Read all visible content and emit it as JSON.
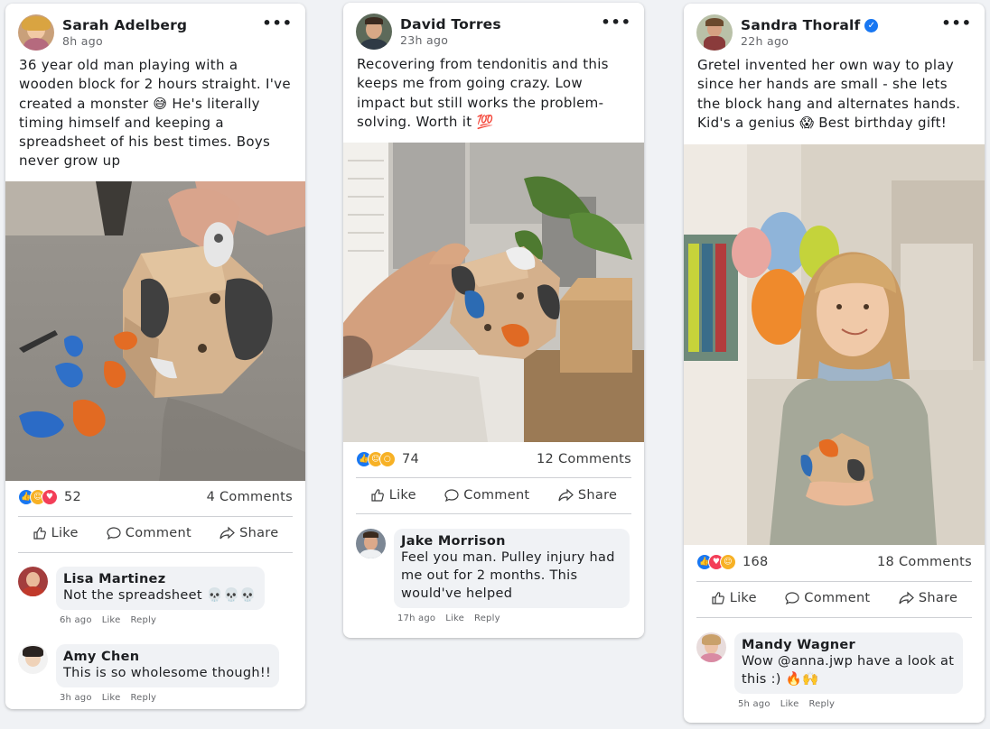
{
  "posts": [
    {
      "author": "Sarah Adelberg",
      "time": "8h ago",
      "more": "•••",
      "text": "36 year old man playing with a wooden block for 2 hours straight. I've created a monster 😅 He's literally timing himself and keeping a spreadsheet of his best times. Boys never grow up",
      "reaction_count": "52",
      "comments_label": "4 Comments",
      "actions": {
        "like": "Like",
        "comment": "Comment",
        "share": "Share"
      },
      "comments": [
        {
          "name": "Lisa Martinez",
          "text": "Not the spreadsheet 💀💀💀",
          "time": "6h ago",
          "like": "Like",
          "reply": "Reply"
        },
        {
          "name": "Amy Chen",
          "text": "This is so wholesome though!!",
          "time": "3h ago",
          "like": "Like",
          "reply": "Reply"
        }
      ]
    },
    {
      "author": "David Torres",
      "time": "23h ago",
      "more": "•••",
      "text": "Recovering from tendonitis and this keeps me from going crazy. Low impact but still works the problem-solving. Worth it 💯",
      "reaction_count": "74",
      "comments_label": "12 Comments",
      "actions": {
        "like": "Like",
        "comment": "Comment",
        "share": "Share"
      },
      "comments": [
        {
          "name": "Jake Morrison",
          "text": "Feel you man. Pulley injury had me out for 2 months. This would've helped",
          "time": "17h ago",
          "like": "Like",
          "reply": "Reply"
        }
      ]
    },
    {
      "author": "Sandra Thoralf",
      "verified": "✓",
      "time": "22h ago",
      "more": "•••",
      "text": "Gretel invented her own way to play since her hands are small - she lets the block hang and alternates hands. Kid's a genius 😱 Best birthday gift!",
      "reaction_count": "168",
      "comments_label": "18 Comments",
      "actions": {
        "like": "Like",
        "comment": "Comment",
        "share": "Share"
      },
      "comments": [
        {
          "name": "Mandy Wagner",
          "text": "Wow @anna.jwp have a look at this :) 🔥🙌",
          "time": "5h ago",
          "like": "Like",
          "reply": "Reply"
        }
      ]
    }
  ],
  "colors": {
    "like_blue": "#1877f2",
    "love_red": "#f33e58",
    "haha_yellow": "#f7b125",
    "text": "#1c1e21",
    "muted": "#65676b"
  }
}
